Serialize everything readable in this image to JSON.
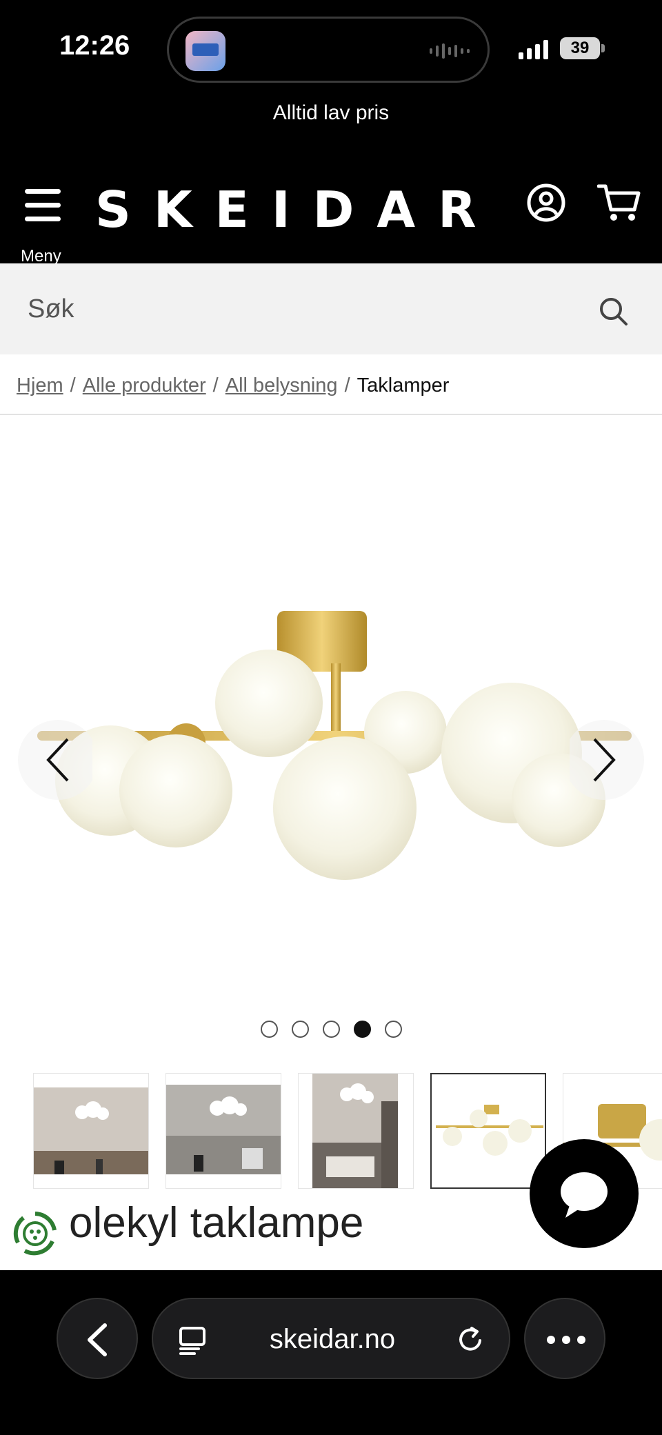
{
  "status_bar": {
    "time": "12:26",
    "battery": "39"
  },
  "promo": {
    "text": "Alltid lav pris"
  },
  "header": {
    "menu_label": "Meny",
    "logo": "SKEIDAR"
  },
  "search": {
    "placeholder": "Søk"
  },
  "breadcrumb": {
    "items": [
      "Hjem",
      "Alle produkter",
      "All belysning"
    ],
    "current": "Taklamper"
  },
  "gallery": {
    "image_count": 5,
    "active_index": 4
  },
  "product": {
    "title_visible": "olekyl taklampe"
  },
  "browser": {
    "url": "skeidar.no"
  },
  "colors": {
    "accent": "#000000",
    "gold": "#c9a646",
    "globe": "#f6f4e6"
  }
}
